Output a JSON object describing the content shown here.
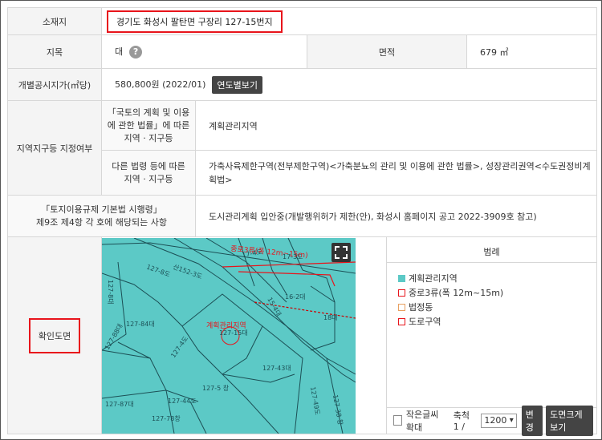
{
  "rows": {
    "location": {
      "label": "소재지",
      "value": "경기도 화성시 팔탄면 구장리 127-15번지"
    },
    "land_category": {
      "label": "지목",
      "value": "대",
      "help_icon": "question-icon",
      "area_label": "면적",
      "area_value": "679 ㎡"
    },
    "land_price": {
      "label": "개별공시지가(㎡당)",
      "value": "580,800원 (2022/01)",
      "button": "연도별보기"
    },
    "zone": {
      "label": "지역지구등 지정여부",
      "law1_label": "「국토의 계획 및 이용에 관한 법률」에 따른 지역 · 지구등",
      "law1_value": "계획관리지역",
      "law2_label": "다른 법령 등에 따른 지역 · 지구등",
      "law2_value": "가축사육제한구역(전부제한구역)<가축분뇨의 관리 및 이용에 관한 법률>, 성장관리권역<수도권정비계획법>"
    },
    "regulation": {
      "label_line1": "「토지이용규제 기본법 시행령」",
      "label_line2": "제9조 제4항 각 호에 해당되는 사항",
      "value": "도시관리계획 입안중(개발행위허가 제한(안), 화성시 홈페이지 공고 2022-3909호 참고)"
    },
    "map": {
      "label": "확인도면"
    }
  },
  "map": {
    "road_label": "중로3류(폭 12m~15m)",
    "zone_label": "계획관리지역",
    "target_lot": "127-15대",
    "expand_icon": "fullscreen-icon",
    "parcels": [
      "17-4도",
      "17-3도",
      "산152-3도",
      "127-8도",
      "16-2대",
      "15-4대",
      "127-8대",
      "127-84대",
      "18대",
      "127-4도",
      "127-43대",
      "127-5 창",
      "127-87대",
      "127-49도",
      "127-38 창",
      "127-78창",
      "127-44도",
      "127-88대"
    ]
  },
  "legend": {
    "title": "범례",
    "items": [
      {
        "label": "계획관리지역",
        "color": "#5cc9c6",
        "fill": true
      },
      {
        "label": "중로3류(폭 12m~15m)",
        "color": "#e8141b",
        "fill": false
      },
      {
        "label": "법정동",
        "color": "#e8a060",
        "fill": false
      },
      {
        "label": "도로구역",
        "color": "#e8141b",
        "fill": false
      }
    ]
  },
  "controls": {
    "checkbox_label": "작은글씨확대",
    "scale_label": "축척 1 /",
    "scale_value": "1200",
    "change_button": "변경",
    "large_button": "도면크게보기"
  }
}
